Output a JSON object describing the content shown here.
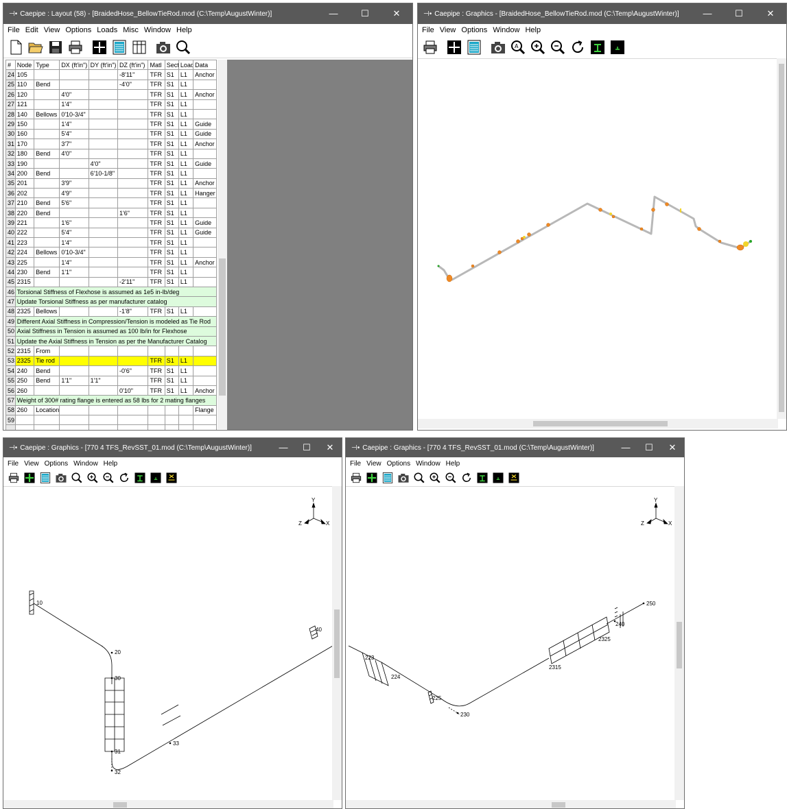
{
  "layout_window": {
    "title": "Caepipe : Layout  (58)  -  [BraidedHose_BellowTieRod.mod (C:\\Temp\\AugustWinter)]",
    "menu": [
      "File",
      "Edit",
      "View",
      "Options",
      "Loads",
      "Misc",
      "Window",
      "Help"
    ],
    "columns": [
      "#",
      "Node",
      "Type",
      "DX (ft'in\")",
      "DY (ft'in\")",
      "DZ (ft'in\")",
      "Matl",
      "Sect",
      "Load",
      "Data"
    ],
    "rows": [
      {
        "n": "24",
        "node": "105",
        "type": "",
        "dx": "",
        "dy": "",
        "dz": "-8'11\"",
        "matl": "TFR",
        "sect": "S1",
        "load": "L1",
        "data": "Anchor"
      },
      {
        "n": "25",
        "node": "110",
        "type": "Bend",
        "dx": "",
        "dy": "",
        "dz": "-4'0\"",
        "matl": "TFR",
        "sect": "S1",
        "load": "L1",
        "data": ""
      },
      {
        "n": "26",
        "node": "120",
        "type": "",
        "dx": "4'0\"",
        "dy": "",
        "dz": "",
        "matl": "TFR",
        "sect": "S1",
        "load": "L1",
        "data": "Anchor"
      },
      {
        "n": "27",
        "node": "121",
        "type": "",
        "dx": "1'4\"",
        "dy": "",
        "dz": "",
        "matl": "TFR",
        "sect": "S1",
        "load": "L1",
        "data": ""
      },
      {
        "n": "28",
        "node": "140",
        "type": "Bellows",
        "dx": "0'10-3/4\"",
        "dy": "",
        "dz": "",
        "matl": "TFR",
        "sect": "S1",
        "load": "L1",
        "data": ""
      },
      {
        "n": "29",
        "node": "150",
        "type": "",
        "dx": "1'4\"",
        "dy": "",
        "dz": "",
        "matl": "TFR",
        "sect": "S1",
        "load": "L1",
        "data": "Guide"
      },
      {
        "n": "30",
        "node": "160",
        "type": "",
        "dx": "5'4\"",
        "dy": "",
        "dz": "",
        "matl": "TFR",
        "sect": "S1",
        "load": "L1",
        "data": "Guide"
      },
      {
        "n": "31",
        "node": "170",
        "type": "",
        "dx": "3'7\"",
        "dy": "",
        "dz": "",
        "matl": "TFR",
        "sect": "S1",
        "load": "L1",
        "data": "Anchor"
      },
      {
        "n": "32",
        "node": "180",
        "type": "Bend",
        "dx": "4'0\"",
        "dy": "",
        "dz": "",
        "matl": "TFR",
        "sect": "S1",
        "load": "L1",
        "data": ""
      },
      {
        "n": "33",
        "node": "190",
        "type": "",
        "dx": "",
        "dy": "4'0\"",
        "dz": "",
        "matl": "TFR",
        "sect": "S1",
        "load": "L1",
        "data": "Guide"
      },
      {
        "n": "34",
        "node": "200",
        "type": "Bend",
        "dx": "",
        "dy": "6'10-1/8\"",
        "dz": "",
        "matl": "TFR",
        "sect": "S1",
        "load": "L1",
        "data": ""
      },
      {
        "n": "35",
        "node": "201",
        "type": "",
        "dx": "3'9\"",
        "dy": "",
        "dz": "",
        "matl": "TFR",
        "sect": "S1",
        "load": "L1",
        "data": "Anchor"
      },
      {
        "n": "36",
        "node": "202",
        "type": "",
        "dx": "4'9\"",
        "dy": "",
        "dz": "",
        "matl": "TFR",
        "sect": "S1",
        "load": "L1",
        "data": "Hanger"
      },
      {
        "n": "37",
        "node": "210",
        "type": "Bend",
        "dx": "5'6\"",
        "dy": "",
        "dz": "",
        "matl": "TFR",
        "sect": "S1",
        "load": "L1",
        "data": ""
      },
      {
        "n": "38",
        "node": "220",
        "type": "Bend",
        "dx": "",
        "dy": "",
        "dz": "1'6\"",
        "matl": "TFR",
        "sect": "S1",
        "load": "L1",
        "data": ""
      },
      {
        "n": "39",
        "node": "221",
        "type": "",
        "dx": "1'6\"",
        "dy": "",
        "dz": "",
        "matl": "TFR",
        "sect": "S1",
        "load": "L1",
        "data": "Guide"
      },
      {
        "n": "40",
        "node": "222",
        "type": "",
        "dx": "5'4\"",
        "dy": "",
        "dz": "",
        "matl": "TFR",
        "sect": "S1",
        "load": "L1",
        "data": "Guide"
      },
      {
        "n": "41",
        "node": "223",
        "type": "",
        "dx": "1'4\"",
        "dy": "",
        "dz": "",
        "matl": "TFR",
        "sect": "S1",
        "load": "L1",
        "data": ""
      },
      {
        "n": "42",
        "node": "224",
        "type": "Bellows",
        "dx": "0'10-3/4\"",
        "dy": "",
        "dz": "",
        "matl": "TFR",
        "sect": "S1",
        "load": "L1",
        "data": ""
      },
      {
        "n": "43",
        "node": "225",
        "type": "",
        "dx": "1'4\"",
        "dy": "",
        "dz": "",
        "matl": "TFR",
        "sect": "S1",
        "load": "L1",
        "data": "Anchor"
      },
      {
        "n": "44",
        "node": "230",
        "type": "Bend",
        "dx": "1'1\"",
        "dy": "",
        "dz": "",
        "matl": "TFR",
        "sect": "S1",
        "load": "L1",
        "data": ""
      },
      {
        "n": "45",
        "node": "2315",
        "type": "",
        "dx": "",
        "dy": "",
        "dz": "-2'11\"",
        "matl": "TFR",
        "sect": "S1",
        "load": "L1",
        "data": ""
      },
      {
        "n": "46",
        "note": "Torsional Stiffness of Flexhose is assumed as 1e5 in-lb/deg"
      },
      {
        "n": "47",
        "note": "Update Torsional Stiffness as per manufacturer catalog"
      },
      {
        "n": "48",
        "node": "2325",
        "type": "Bellows",
        "dx": "",
        "dy": "",
        "dz": "-1'8\"",
        "matl": "TFR",
        "sect": "S1",
        "load": "L1",
        "data": ""
      },
      {
        "n": "49",
        "note": "Different Axial Stiffness in Compression/Tension is modeled as Tie Rod"
      },
      {
        "n": "50",
        "note": "Axial Stiffness in Tension is assumed as 100 lb/in for Flexhose"
      },
      {
        "n": "51",
        "note": "Update the Axial Stiffness in Tension as per the Manufacturer Catalog"
      },
      {
        "n": "52",
        "node": "2315",
        "type": "From",
        "dx": "",
        "dy": "",
        "dz": "",
        "matl": "",
        "sect": "",
        "load": "",
        "data": ""
      },
      {
        "n": "53",
        "node": "2325",
        "type": "Tie rod",
        "dx": "",
        "dy": "",
        "dz": "",
        "matl": "TFR",
        "sect": "S1",
        "load": "L1",
        "data": "",
        "hl": true
      },
      {
        "n": "54",
        "node": "240",
        "type": "Bend",
        "dx": "",
        "dy": "",
        "dz": "-0'6\"",
        "matl": "TFR",
        "sect": "S1",
        "load": "L1",
        "data": ""
      },
      {
        "n": "55",
        "node": "250",
        "type": "Bend",
        "dx": "1'1\"",
        "dy": "1'1\"",
        "dz": "",
        "matl": "TFR",
        "sect": "S1",
        "load": "L1",
        "data": ""
      },
      {
        "n": "56",
        "node": "260",
        "type": "",
        "dx": "",
        "dy": "",
        "dz": "0'10\"",
        "matl": "TFR",
        "sect": "S1",
        "load": "L1",
        "data": "Anchor"
      },
      {
        "n": "57",
        "note": "Weight of 300# rating flange is entered as 58 lbs for 2 mating flanges"
      },
      {
        "n": "58",
        "node": "260",
        "type": "Location",
        "dx": "",
        "dy": "",
        "dz": "",
        "matl": "",
        "sect": "",
        "load": "",
        "data": "Flange"
      },
      {
        "n": "59",
        "node": "",
        "type": "",
        "dx": "",
        "dy": "",
        "dz": "",
        "matl": "",
        "sect": "",
        "load": "",
        "data": ""
      },
      {
        "n": "",
        "node": "",
        "type": "",
        "dx": "",
        "dy": "",
        "dz": "",
        "matl": "",
        "sect": "",
        "load": "",
        "data": ""
      }
    ]
  },
  "graphics_window_1": {
    "title": "Caepipe : Graphics  -  [BraidedHose_BellowTieRod.mod (C:\\Temp\\AugustWinter)]",
    "menu": [
      "File",
      "View",
      "Options",
      "Window",
      "Help"
    ]
  },
  "graphics_window_2": {
    "title": "Caepipe : Graphics  -  [770 4 TFS_RevSST_01.mod (C:\\Temp\\AugustWinter)]",
    "menu": [
      "File",
      "View",
      "Options",
      "Window",
      "Help"
    ],
    "axes": {
      "y": "Y",
      "z": "Z",
      "x": "X"
    },
    "nodes": {
      "n10": "10",
      "n20": "20",
      "n30": "30",
      "n31": "31",
      "n32": "32",
      "n33": "33",
      "n40": "40"
    }
  },
  "graphics_window_3": {
    "title": "Caepipe : Graphics  -  [770 4 TFS_RevSST_01.mod (C:\\Temp\\AugustWinter)]",
    "menu": [
      "File",
      "View",
      "Options",
      "Window",
      "Help"
    ],
    "axes": {
      "y": "Y",
      "z": "Z",
      "x": "X"
    },
    "nodes": {
      "n223": "223",
      "n224": "224",
      "n225": "225",
      "n230": "230",
      "n2315": "2315",
      "n2325": "2325",
      "n240": "240",
      "n250": "250"
    }
  },
  "window_controls": {
    "minimize": "—",
    "maximize": "☐",
    "close": "✕"
  },
  "colors": {
    "titlebar": "#595959",
    "note_row": "#ddfbdd",
    "highlight_row": "#ffff00",
    "workspace": "#808080",
    "pipe": "#b8b8b8",
    "fitting": "#f08a24"
  }
}
